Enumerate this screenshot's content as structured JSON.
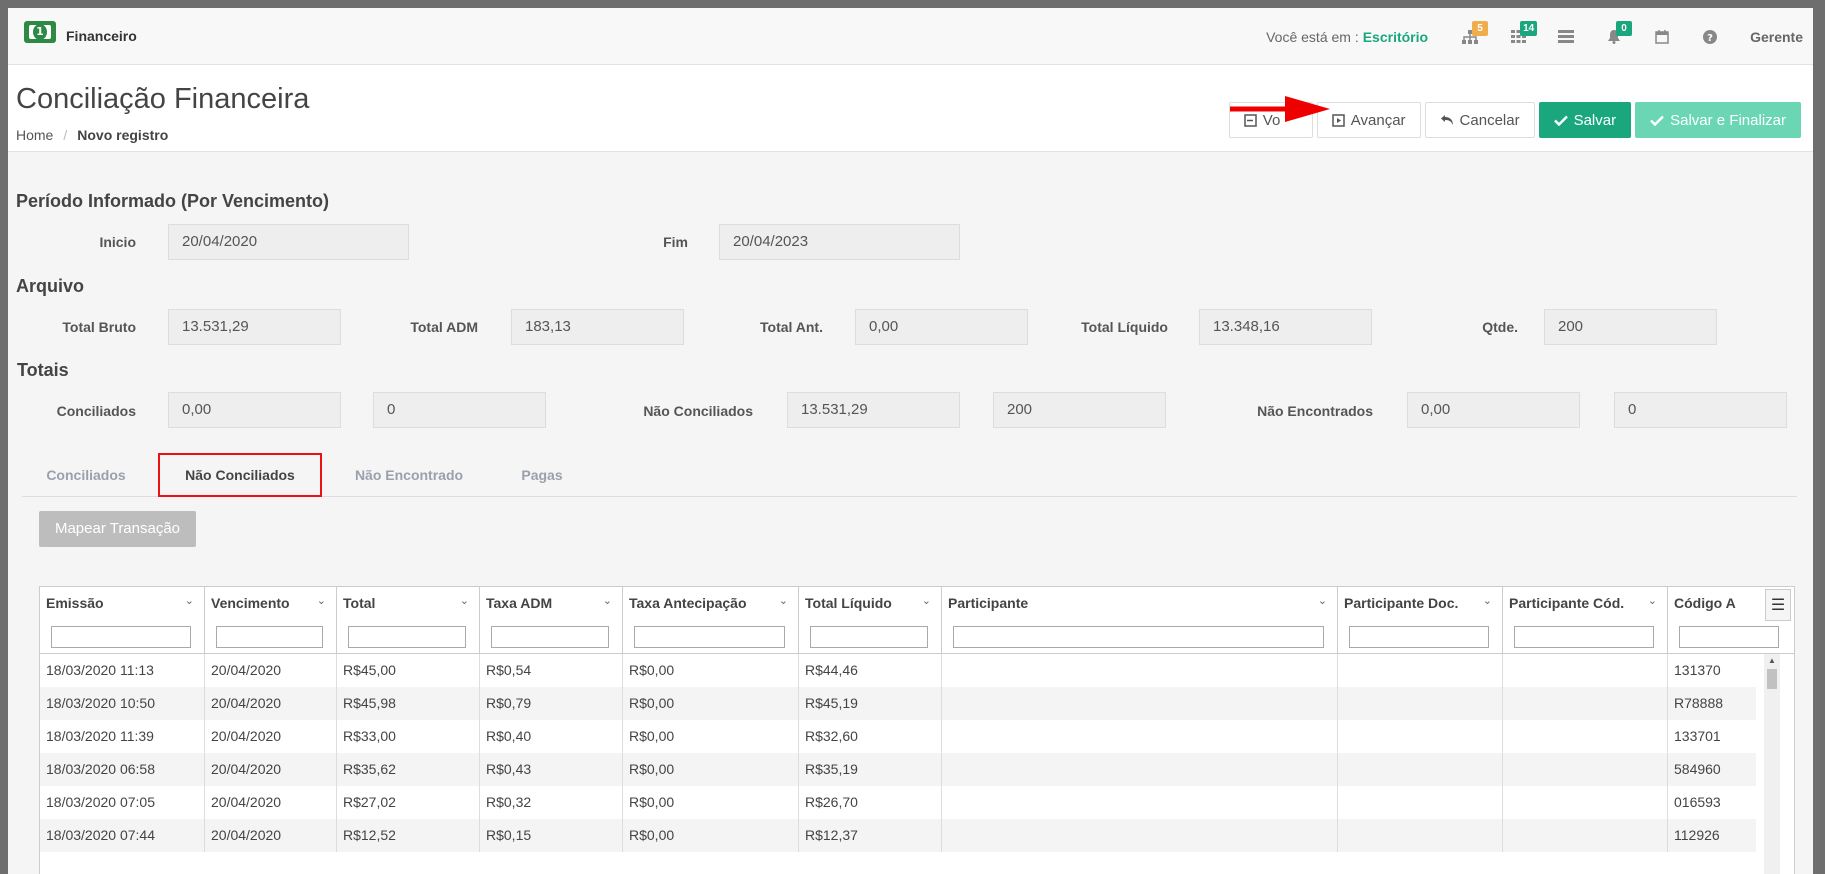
{
  "topbar": {
    "app_name": "Financeiro",
    "location_label": "Você está em :",
    "location_value": "Escritório",
    "badges": {
      "sitemap": "5",
      "grid": "14",
      "notifications": "0"
    },
    "badge_colors": {
      "sitemap": "#f0ad4e",
      "grid": "#1aa77e",
      "notifications": "#1aa77e"
    },
    "user": "Gerente"
  },
  "header": {
    "title": "Conciliação Financeira",
    "breadcrumb": {
      "home": "Home",
      "separator": "/",
      "current": "Novo registro"
    },
    "buttons": {
      "voltar": "Vo",
      "avancar": "Avançar",
      "cancelar": "Cancelar",
      "salvar": "Salvar",
      "salvar_finalizar": "Salvar e Finalizar"
    }
  },
  "periodo": {
    "title": "Período Informado (Por Vencimento)",
    "inicio_label": "Inicio",
    "inicio_value": "20/04/2020",
    "fim_label": "Fim",
    "fim_value": "20/04/2023"
  },
  "arquivo": {
    "title": "Arquivo",
    "total_bruto_label": "Total Bruto",
    "total_bruto": "13.531,29",
    "total_adm_label": "Total ADM",
    "total_adm": "183,13",
    "total_ant_label": "Total Ant.",
    "total_ant": "0,00",
    "total_liquido_label": "Total Líquido",
    "total_liquido": "13.348,16",
    "qtde_label": "Qtde.",
    "qtde": "200"
  },
  "totais": {
    "title": "Totais",
    "conciliados_label": "Conciliados",
    "conciliados_valor": "0,00",
    "conciliados_qtd": "0",
    "nao_conciliados_label": "Não Conciliados",
    "nao_conciliados_valor": "13.531,29",
    "nao_conciliados_qtd": "200",
    "nao_encontrados_label": "Não Encontrados",
    "nao_encontrados_valor": "0,00",
    "nao_encontrados_qtd": "0"
  },
  "tabs": [
    "Conciliados",
    "Não Conciliados",
    "Não Encontrado",
    "Pagas"
  ],
  "active_tab": "Não Conciliados",
  "map_button": "Mapear Transação",
  "grid": {
    "columns": [
      "Emissão",
      "Vencimento",
      "Total",
      "Taxa ADM",
      "Taxa Antecipação",
      "Total Líquido",
      "Participante",
      "Participante Doc.",
      "Participante Cód.",
      "Código A"
    ],
    "rows": [
      [
        "18/03/2020 11:13",
        "20/04/2020",
        "R$45,00",
        "R$0,54",
        "R$0,00",
        "R$44,46",
        "",
        "",
        "",
        "131370"
      ],
      [
        "18/03/2020 10:50",
        "20/04/2020",
        "R$45,98",
        "R$0,79",
        "R$0,00",
        "R$45,19",
        "",
        "",
        "",
        "R78888"
      ],
      [
        "18/03/2020 11:39",
        "20/04/2020",
        "R$33,00",
        "R$0,40",
        "R$0,00",
        "R$32,60",
        "",
        "",
        "",
        "133701"
      ],
      [
        "18/03/2020 06:58",
        "20/04/2020",
        "R$35,62",
        "R$0,43",
        "R$0,00",
        "R$35,19",
        "",
        "",
        "",
        "584960"
      ],
      [
        "18/03/2020 07:05",
        "20/04/2020",
        "R$27,02",
        "R$0,32",
        "R$0,00",
        "R$26,70",
        "",
        "",
        "",
        "016593"
      ],
      [
        "18/03/2020 07:44",
        "20/04/2020",
        "R$12,52",
        "R$0,15",
        "R$0,00",
        "R$12,37",
        "",
        "",
        "",
        "112926"
      ]
    ]
  }
}
